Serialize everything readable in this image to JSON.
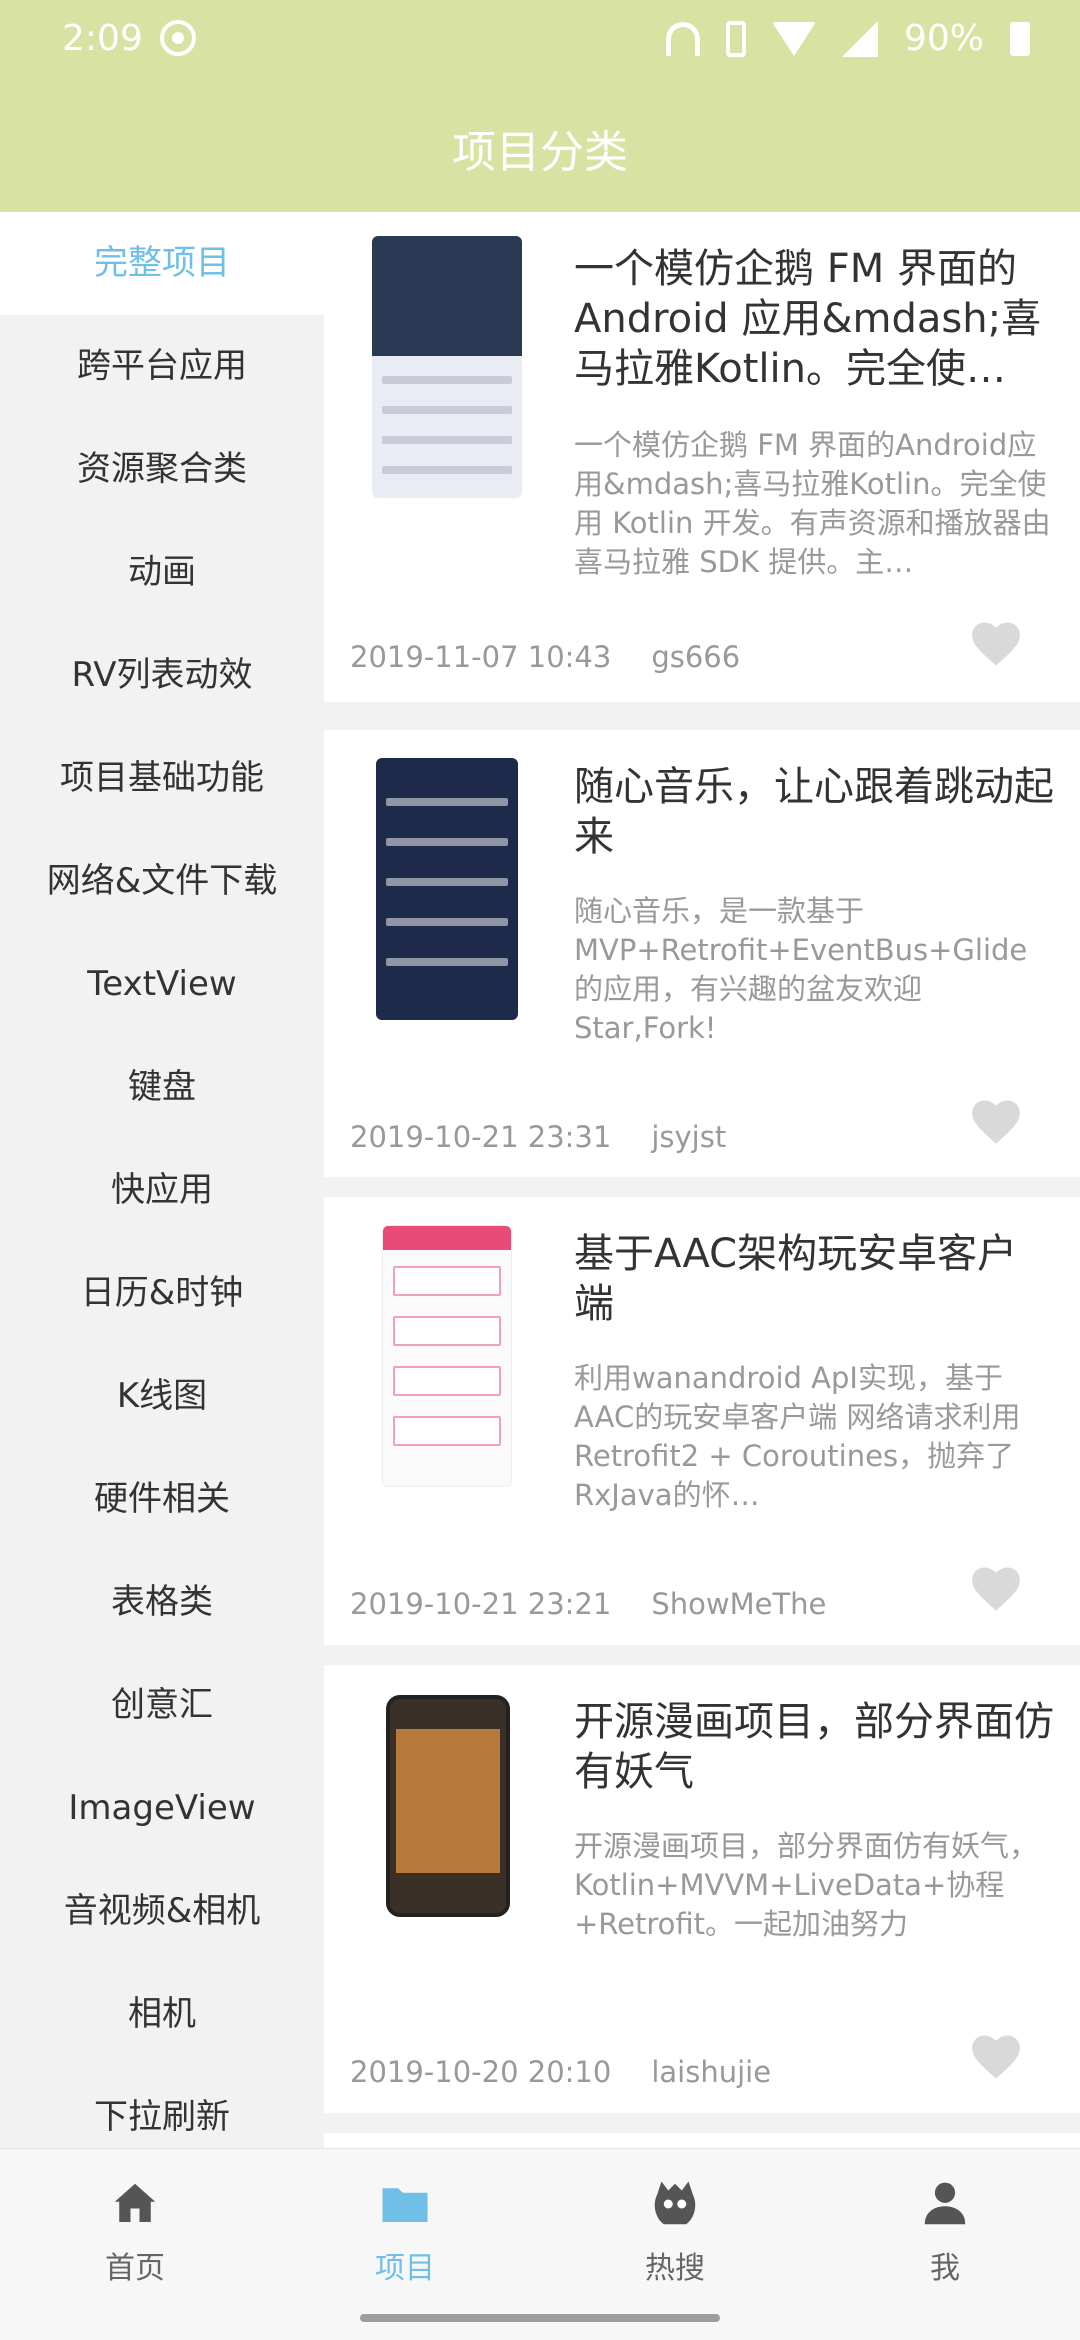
{
  "status": {
    "time": "2:09",
    "battery": "90%"
  },
  "header": {
    "title": "项目分类"
  },
  "sidebar": {
    "items": [
      {
        "label": "完整项目",
        "active": true
      },
      {
        "label": "跨平台应用"
      },
      {
        "label": "资源聚合类"
      },
      {
        "label": "动画"
      },
      {
        "label": "RV列表动效"
      },
      {
        "label": "项目基础功能"
      },
      {
        "label": "网络&文件下载"
      },
      {
        "label": "TextView"
      },
      {
        "label": "键盘"
      },
      {
        "label": "快应用"
      },
      {
        "label": "日历&时钟"
      },
      {
        "label": "K线图"
      },
      {
        "label": "硬件相关"
      },
      {
        "label": "表格类"
      },
      {
        "label": "创意汇"
      },
      {
        "label": "ImageView"
      },
      {
        "label": "音视频&相机"
      },
      {
        "label": "相机"
      },
      {
        "label": "下拉刷新"
      }
    ]
  },
  "cards": [
    {
      "title": "一个模仿企鹅 FM 界面的 Android 应用&mdash;喜马拉雅Kotlin。完全使…",
      "desc": "一个模仿企鹅 FM 界面的Android应用&mdash;喜马拉雅Kotlin。完全使用 Kotlin 开发。有声资源和播放器由喜马拉雅 SDK 提供。主…",
      "date": "2019-11-07 10:43",
      "author": "gs666"
    },
    {
      "title": "随心音乐，让心跟着跳动起来",
      "desc": "随心音乐，是一款基于MVP+Retrofit+EventBus+Glide的应用，有兴趣的盆友欢迎Star,Fork!",
      "date": "2019-10-21 23:31",
      "author": "jsyjst"
    },
    {
      "title": "基于AAC架构玩安卓客户端",
      "desc": "利用wanandroid ApI实现，基于AAC的玩安卓客户端 网络请求利用Retrofit2 + Coroutines，抛弃了RxJava的怀…",
      "date": "2019-10-21 23:21",
      "author": "ShowMeThe"
    },
    {
      "title": "开源漫画项目，部分界面仿有妖气",
      "desc": "开源漫画项目，部分界面仿有妖气，Kotlin+MVVM+LiveData+协程+Retrofit。一起加油努力",
      "date": "2019-10-20 20:10",
      "author": "laishujie"
    }
  ],
  "tabs": [
    {
      "label": "首页",
      "icon": "home-icon"
    },
    {
      "label": "项目",
      "icon": "folder-icon",
      "active": true
    },
    {
      "label": "热搜",
      "icon": "monster-icon"
    },
    {
      "label": "我",
      "icon": "person-icon"
    }
  ],
  "colors": {
    "header": "#d8e3a3",
    "accent": "#6fbfe6"
  }
}
